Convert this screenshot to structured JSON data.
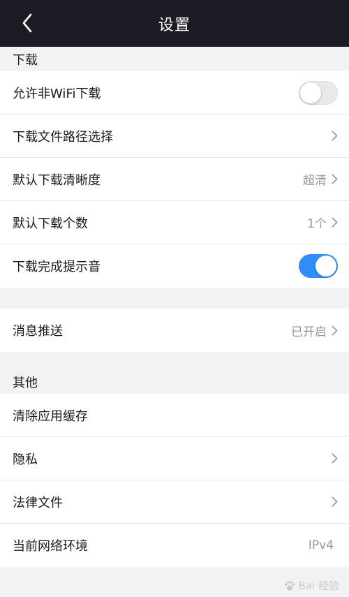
{
  "header": {
    "title": "设置",
    "back_icon": "chevron-left-icon"
  },
  "sections": [
    {
      "title": "下载",
      "items": [
        {
          "label": "允许非WiFi下载",
          "control": "toggle",
          "toggle_on": false
        },
        {
          "label": "下载文件路径选择",
          "control": "chevron",
          "value": ""
        },
        {
          "label": "默认下载清晰度",
          "control": "chevron",
          "value": "超清"
        },
        {
          "label": "默认下载个数",
          "control": "chevron",
          "value": "1个"
        },
        {
          "label": "下载完成提示音",
          "control": "toggle",
          "toggle_on": true
        }
      ]
    },
    {
      "title": "",
      "items": [
        {
          "label": "消息推送",
          "control": "chevron",
          "value": "已开启"
        }
      ]
    },
    {
      "title": "其他",
      "items": [
        {
          "label": "清除应用缓存",
          "control": "none",
          "value": ""
        },
        {
          "label": "隐私",
          "control": "chevron",
          "value": ""
        },
        {
          "label": "法律文件",
          "control": "chevron",
          "value": ""
        },
        {
          "label": "当前网络环境",
          "control": "none",
          "value": "IPv4"
        }
      ]
    }
  ],
  "watermark": {
    "text": "Bai 经验"
  },
  "colors": {
    "navbar": "#1c1d24",
    "toggle_on": "#2f8ef7",
    "background": "#f2f2f4"
  }
}
